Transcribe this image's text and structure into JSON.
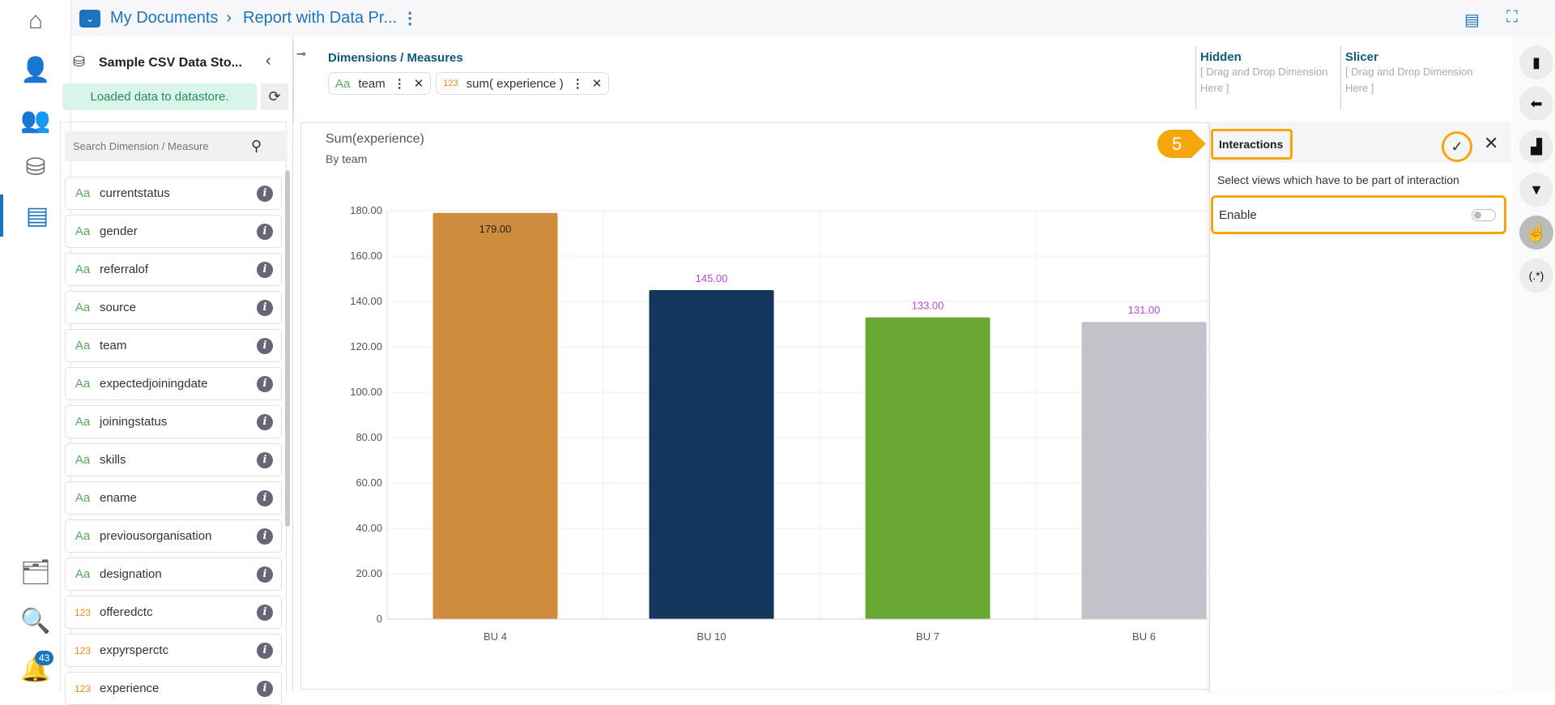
{
  "breadcrumb": {
    "root": "My Documents",
    "current": "Report with Data Pr..."
  },
  "nav": {
    "notification_count": "43"
  },
  "datastore": {
    "name": "Sample CSV Data Sto...",
    "status": "Loaded data to datastore.",
    "search_placeholder": "Search Dimension / Measure"
  },
  "fields": [
    {
      "type": "Aa",
      "name": "currentstatus"
    },
    {
      "type": "Aa",
      "name": "gender"
    },
    {
      "type": "Aa",
      "name": "referralof"
    },
    {
      "type": "Aa",
      "name": "source"
    },
    {
      "type": "Aa",
      "name": "team"
    },
    {
      "type": "Aa",
      "name": "expectedjoiningdate"
    },
    {
      "type": "Aa",
      "name": "joiningstatus"
    },
    {
      "type": "Aa",
      "name": "skills"
    },
    {
      "type": "Aa",
      "name": "ename"
    },
    {
      "type": "Aa",
      "name": "previousorganisation"
    },
    {
      "type": "Aa",
      "name": "designation"
    },
    {
      "type": "123",
      "name": "offeredctc"
    },
    {
      "type": "123",
      "name": "expyrsperctc"
    },
    {
      "type": "123",
      "name": "experience"
    }
  ],
  "shelf": {
    "title": "Dimensions / Measures",
    "chips": [
      {
        "type": "Aa",
        "label": "team"
      },
      {
        "type": "123",
        "label": "sum( experience )"
      }
    ],
    "hidden_title": "Hidden",
    "hidden_placeholder": "[ Drag and Drop Dimension Here ]",
    "slicer_title": "Slicer",
    "slicer_placeholder": "[ Drag and Drop Dimension Here ]"
  },
  "interactions": {
    "step": "5",
    "title": "Interactions",
    "description": "Select views which have to be part of interaction",
    "enable_label": "Enable",
    "enabled": false
  },
  "right_toolbar": {
    "regex_label": "(.*)"
  },
  "colors": {
    "accent": "#1c74bc",
    "highlight": "#f5a60b"
  },
  "chart_data": {
    "type": "bar",
    "title": "Sum(experience)",
    "subtitle": "By team",
    "categories": [
      "BU 4",
      "BU 10",
      "BU 7",
      "BU 6"
    ],
    "values": [
      179,
      145,
      133,
      131
    ],
    "value_labels": [
      "179.00",
      "145.00",
      "133.00",
      "131.00"
    ],
    "colors": [
      "#d08c3d",
      "#14355c",
      "#6aa834",
      "#c3c2cb"
    ],
    "ylim": [
      0,
      180
    ],
    "yticks": [
      "0",
      "20.00",
      "40.00",
      "60.00",
      "80.00",
      "100.00",
      "120.00",
      "140.00",
      "160.00",
      "180.00"
    ],
    "grid": true
  }
}
